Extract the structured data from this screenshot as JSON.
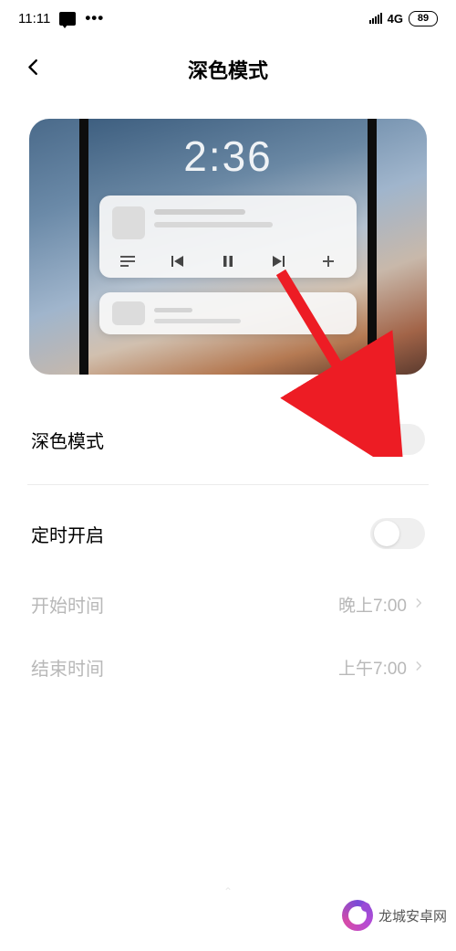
{
  "status": {
    "time": "11:11",
    "network_label": "4G",
    "battery_text": "89"
  },
  "nav": {
    "title": "深色模式"
  },
  "preview": {
    "clock": "2:36"
  },
  "settings": {
    "dark_mode_label": "深色模式",
    "schedule_label": "定时开启",
    "start_label": "开始时间",
    "start_value": "晚上7:00",
    "end_label": "结束时间",
    "end_value": "上午7:00"
  },
  "watermark": {
    "text": "龙城安卓网"
  }
}
